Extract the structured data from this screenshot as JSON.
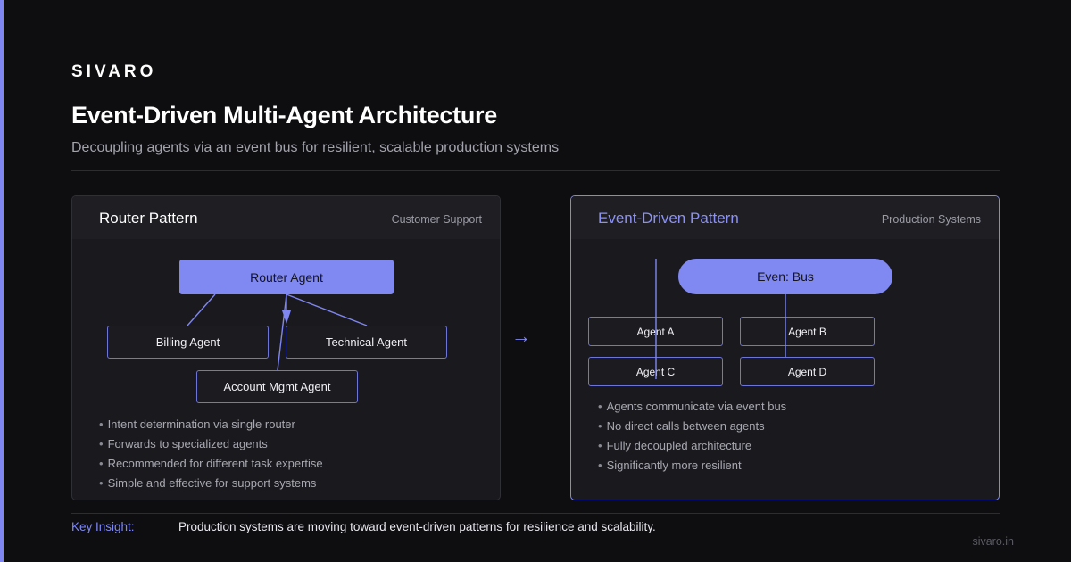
{
  "brand": "SIVARO",
  "title": "Event-Driven Multi-Agent Architecture",
  "subtitle": "Decoupling agents via an event bus for resilient, scalable production systems",
  "arrow": "→",
  "left_panel": {
    "title": "Router Pattern",
    "tag": "Customer Support",
    "router": "Router Agent",
    "agents": [
      "Billing Agent",
      "Technical Agent",
      "Account Mgmt Agent"
    ],
    "bullets": [
      "Intent determination via single router",
      "Forwards to specialized agents",
      "Recommended for different task expertise",
      "Simple and effective for support systems"
    ]
  },
  "right_panel": {
    "title": "Event-Driven Pattern",
    "tag": "Production Systems",
    "bus": "Even: Bus",
    "agents": [
      "Agent A",
      "Agent B",
      "Agent C",
      "Agent D"
    ],
    "bullets": [
      "Agents communicate via event bus",
      "No direct calls between agents",
      "Fully decoupled architecture",
      "Significantly more resilient"
    ]
  },
  "footer": {
    "insight_label": "Key Insight:",
    "insight_text": "Production systems are moving toward event-driven patterns for resilience and scalability.",
    "site": "sivaro.in"
  },
  "colors": {
    "accent": "#7f86f0",
    "background": "#0e0e11",
    "panel": "#1a1a1e"
  }
}
